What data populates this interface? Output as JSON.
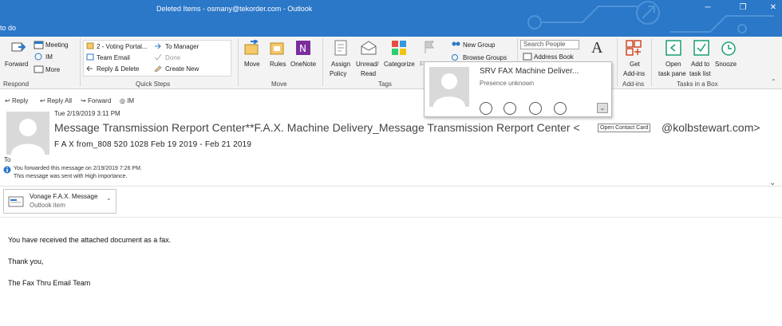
{
  "window": {
    "title": "Deleted Items - osmany@tekorder.com - Outlook",
    "todo_label": "to do",
    "accent": "#2b77c8"
  },
  "ribbon": {
    "respond": {
      "meeting": "Meeting",
      "im": "IM",
      "forward": "Forward",
      "more": "More",
      "group": "Respond"
    },
    "quick_steps": {
      "items": [
        "2 - Voting Portal...",
        "Team Email",
        "Reply & Delete",
        "To Manager",
        "Done",
        "Create New"
      ],
      "group": "Quick Steps"
    },
    "move": {
      "move": "Move",
      "rules": "Rules",
      "onenote": "OneNote",
      "group": "Move"
    },
    "tags": {
      "assign": "Assign",
      "policy": "Policy",
      "unread": "Unread/",
      "read": "Read",
      "categorize": "Categorize",
      "followup": "F",
      "group": "Tags"
    },
    "find": {
      "new_group": "New Group",
      "browse_groups": "Browse Groups",
      "search_people": "Search People",
      "address_book": "Address Book"
    },
    "addins": {
      "get": "Get",
      "addins": "Add-ins",
      "group": "Add-ins"
    },
    "tasks": {
      "open": "Open",
      "task_pane": "task pane",
      "add_to": "Add to",
      "task_list": "task list",
      "snooze": "Snooze",
      "group": "Tasks in a Box"
    }
  },
  "message": {
    "actions": [
      "Reply",
      "Reply All",
      "Forward",
      "IM"
    ],
    "date": "Tue 2/19/2019 3:11 PM",
    "subject": "Message Transmission Rerport Center**F.A.X. Machine Delivery_Message Transmission Rerport Center <",
    "open_card": "Open Contact Card",
    "email_suffix": "@kolbstewart.com>",
    "from": "F A X from_808 520 1028 Feb 19 2019 - Feb 21 2019",
    "to_label": "To",
    "info_line1": "You forwarded this message on 2/19/2019 7:26 PM.",
    "info_line2": "This message was sent with High importance.",
    "attachment": {
      "name": "Vonage F.A.X. Message",
      "type": "Outlook item"
    },
    "body": [
      "You have received the attached document as a fax.",
      "Thank you,",
      "The Fax Thru Email Team"
    ]
  },
  "contact_card": {
    "name": "SRV FAX Machine Deliver...",
    "presence": "Presence unknown"
  }
}
